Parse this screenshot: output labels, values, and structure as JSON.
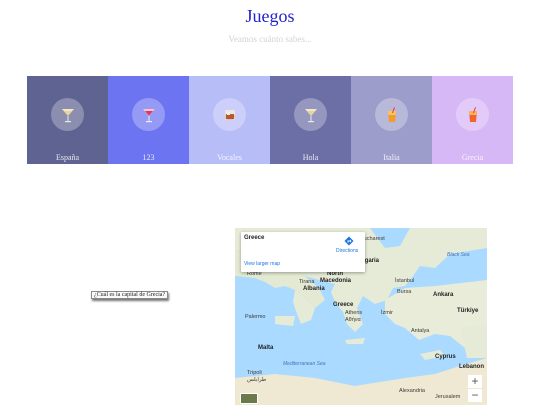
{
  "header": {
    "title": "Juegos",
    "subtitle": "Veamos cuánto sabes..."
  },
  "tiles": [
    {
      "label": "España",
      "color": "#5f6391",
      "icon": "martini-glass-icon"
    },
    {
      "label": "123",
      "color": "#6c74f2",
      "icon": "cocktail-glass-icon"
    },
    {
      "label": "Vocales",
      "color": "#b7bdf7",
      "icon": "whiskey-glass-icon"
    },
    {
      "label": "Hola",
      "color": "#6c6fa6",
      "icon": "martini-glass-icon"
    },
    {
      "label": "Italia",
      "color": "#9d9dcb",
      "icon": "tropical-drink-icon"
    },
    {
      "label": "Grecia",
      "color": "#d7b8f7",
      "icon": "tropical-drink-icon"
    }
  ],
  "question": {
    "text": "¿Cuál es la capital de Grecia?"
  },
  "map": {
    "place": "Greece",
    "directions": "Directions",
    "larger_map": "View larger map",
    "zoom_in": "+",
    "zoom_out": "−",
    "labels": {
      "bucharest": "Bucharest",
      "bulgaria": "Bulgaria",
      "black_sea": "Black Sea",
      "rome": "Rome",
      "north_macedonia_1": "North",
      "north_macedonia_2": "Macedonia",
      "tirana": "Tirana",
      "albania": "Albania",
      "istanbul": "İstanbul",
      "bursa": "Bursa",
      "ankara": "Ankara",
      "greece": "Greece",
      "athens": "Athens",
      "athens_greek": "Αθήνα",
      "izmir": "İzmir",
      "turkiye": "Türkiye",
      "palermo": "Palermo",
      "antalya": "Antalya",
      "malta": "Malta",
      "cyprus": "Cyprus",
      "mediterranean": "Mediterranean Sea",
      "lebanon": "Lebanon",
      "tripoli": "Tripoli",
      "tripoli_arabic": "طرابلس",
      "alexandria": "Alexandria",
      "jerusalem": "Jerusalem"
    }
  }
}
